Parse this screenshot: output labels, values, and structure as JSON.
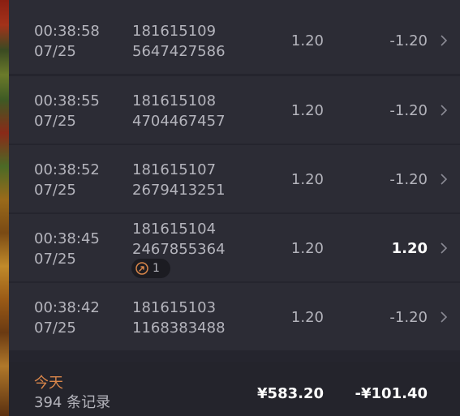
{
  "rows": [
    {
      "time": "00:38:58",
      "date": "07/25",
      "id": "181615109",
      "number": "5647427586",
      "amount": "1.20",
      "balance": "-1.20",
      "positive": false
    },
    {
      "time": "00:38:55",
      "date": "07/25",
      "id": "181615108",
      "number": "4704467457",
      "amount": "1.20",
      "balance": "-1.20",
      "positive": false
    },
    {
      "time": "00:38:52",
      "date": "07/25",
      "id": "181615107",
      "number": "2679413251",
      "amount": "1.20",
      "balance": "-1.20",
      "positive": false
    },
    {
      "time": "00:38:45",
      "date": "07/25",
      "id": "181615104",
      "number": "2467855364",
      "amount": "1.20",
      "balance": "1.20",
      "positive": true,
      "badge_count": "1",
      "badge_icon": "rocket-icon"
    },
    {
      "time": "00:38:42",
      "date": "07/25",
      "id": "181615103",
      "number": "1168383488",
      "amount": "1.20",
      "balance": "-1.20",
      "positive": false
    }
  ],
  "footer": {
    "today_label": "今天",
    "records_label": "394 条记录",
    "total_amount": "¥583.20",
    "total_balance": "-¥101.40"
  },
  "colors": {
    "background": "#2c2c35",
    "footer_background": "#24242c",
    "text": "#b4b4bc",
    "highlight": "#ffffff",
    "today_accent": "#d9864a"
  },
  "icons": {
    "row_arrow": "chevron-right-icon",
    "badge": "rocket-icon"
  }
}
